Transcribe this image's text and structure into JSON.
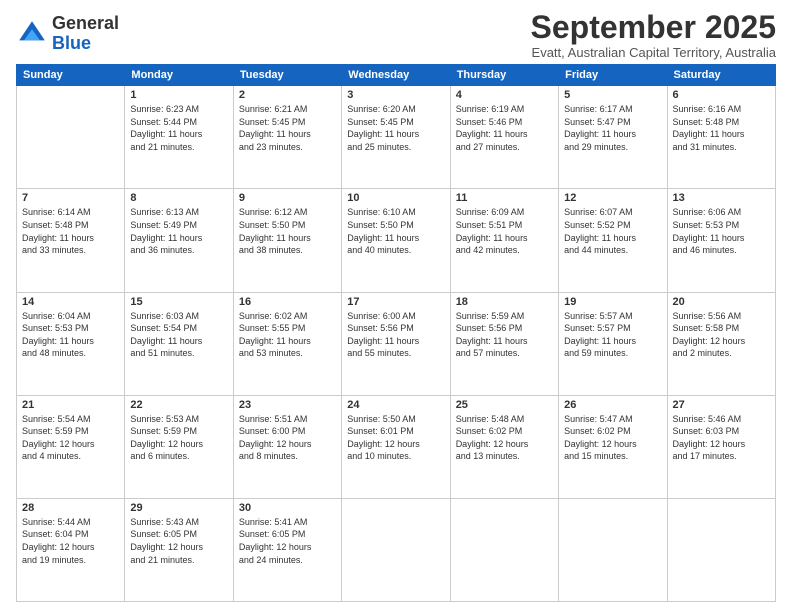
{
  "header": {
    "logo_line1": "General",
    "logo_line2": "Blue",
    "month": "September 2025",
    "location": "Evatt, Australian Capital Territory, Australia"
  },
  "days_of_week": [
    "Sunday",
    "Monday",
    "Tuesday",
    "Wednesday",
    "Thursday",
    "Friday",
    "Saturday"
  ],
  "weeks": [
    [
      {
        "day": "",
        "info": ""
      },
      {
        "day": "1",
        "info": "Sunrise: 6:23 AM\nSunset: 5:44 PM\nDaylight: 11 hours\nand 21 minutes."
      },
      {
        "day": "2",
        "info": "Sunrise: 6:21 AM\nSunset: 5:45 PM\nDaylight: 11 hours\nand 23 minutes."
      },
      {
        "day": "3",
        "info": "Sunrise: 6:20 AM\nSunset: 5:45 PM\nDaylight: 11 hours\nand 25 minutes."
      },
      {
        "day": "4",
        "info": "Sunrise: 6:19 AM\nSunset: 5:46 PM\nDaylight: 11 hours\nand 27 minutes."
      },
      {
        "day": "5",
        "info": "Sunrise: 6:17 AM\nSunset: 5:47 PM\nDaylight: 11 hours\nand 29 minutes."
      },
      {
        "day": "6",
        "info": "Sunrise: 6:16 AM\nSunset: 5:48 PM\nDaylight: 11 hours\nand 31 minutes."
      }
    ],
    [
      {
        "day": "7",
        "info": "Sunrise: 6:14 AM\nSunset: 5:48 PM\nDaylight: 11 hours\nand 33 minutes."
      },
      {
        "day": "8",
        "info": "Sunrise: 6:13 AM\nSunset: 5:49 PM\nDaylight: 11 hours\nand 36 minutes."
      },
      {
        "day": "9",
        "info": "Sunrise: 6:12 AM\nSunset: 5:50 PM\nDaylight: 11 hours\nand 38 minutes."
      },
      {
        "day": "10",
        "info": "Sunrise: 6:10 AM\nSunset: 5:50 PM\nDaylight: 11 hours\nand 40 minutes."
      },
      {
        "day": "11",
        "info": "Sunrise: 6:09 AM\nSunset: 5:51 PM\nDaylight: 11 hours\nand 42 minutes."
      },
      {
        "day": "12",
        "info": "Sunrise: 6:07 AM\nSunset: 5:52 PM\nDaylight: 11 hours\nand 44 minutes."
      },
      {
        "day": "13",
        "info": "Sunrise: 6:06 AM\nSunset: 5:53 PM\nDaylight: 11 hours\nand 46 minutes."
      }
    ],
    [
      {
        "day": "14",
        "info": "Sunrise: 6:04 AM\nSunset: 5:53 PM\nDaylight: 11 hours\nand 48 minutes."
      },
      {
        "day": "15",
        "info": "Sunrise: 6:03 AM\nSunset: 5:54 PM\nDaylight: 11 hours\nand 51 minutes."
      },
      {
        "day": "16",
        "info": "Sunrise: 6:02 AM\nSunset: 5:55 PM\nDaylight: 11 hours\nand 53 minutes."
      },
      {
        "day": "17",
        "info": "Sunrise: 6:00 AM\nSunset: 5:56 PM\nDaylight: 11 hours\nand 55 minutes."
      },
      {
        "day": "18",
        "info": "Sunrise: 5:59 AM\nSunset: 5:56 PM\nDaylight: 11 hours\nand 57 minutes."
      },
      {
        "day": "19",
        "info": "Sunrise: 5:57 AM\nSunset: 5:57 PM\nDaylight: 11 hours\nand 59 minutes."
      },
      {
        "day": "20",
        "info": "Sunrise: 5:56 AM\nSunset: 5:58 PM\nDaylight: 12 hours\nand 2 minutes."
      }
    ],
    [
      {
        "day": "21",
        "info": "Sunrise: 5:54 AM\nSunset: 5:59 PM\nDaylight: 12 hours\nand 4 minutes."
      },
      {
        "day": "22",
        "info": "Sunrise: 5:53 AM\nSunset: 5:59 PM\nDaylight: 12 hours\nand 6 minutes."
      },
      {
        "day": "23",
        "info": "Sunrise: 5:51 AM\nSunset: 6:00 PM\nDaylight: 12 hours\nand 8 minutes."
      },
      {
        "day": "24",
        "info": "Sunrise: 5:50 AM\nSunset: 6:01 PM\nDaylight: 12 hours\nand 10 minutes."
      },
      {
        "day": "25",
        "info": "Sunrise: 5:48 AM\nSunset: 6:02 PM\nDaylight: 12 hours\nand 13 minutes."
      },
      {
        "day": "26",
        "info": "Sunrise: 5:47 AM\nSunset: 6:02 PM\nDaylight: 12 hours\nand 15 minutes."
      },
      {
        "day": "27",
        "info": "Sunrise: 5:46 AM\nSunset: 6:03 PM\nDaylight: 12 hours\nand 17 minutes."
      }
    ],
    [
      {
        "day": "28",
        "info": "Sunrise: 5:44 AM\nSunset: 6:04 PM\nDaylight: 12 hours\nand 19 minutes."
      },
      {
        "day": "29",
        "info": "Sunrise: 5:43 AM\nSunset: 6:05 PM\nDaylight: 12 hours\nand 21 minutes."
      },
      {
        "day": "30",
        "info": "Sunrise: 5:41 AM\nSunset: 6:05 PM\nDaylight: 12 hours\nand 24 minutes."
      },
      {
        "day": "",
        "info": ""
      },
      {
        "day": "",
        "info": ""
      },
      {
        "day": "",
        "info": ""
      },
      {
        "day": "",
        "info": ""
      }
    ]
  ]
}
